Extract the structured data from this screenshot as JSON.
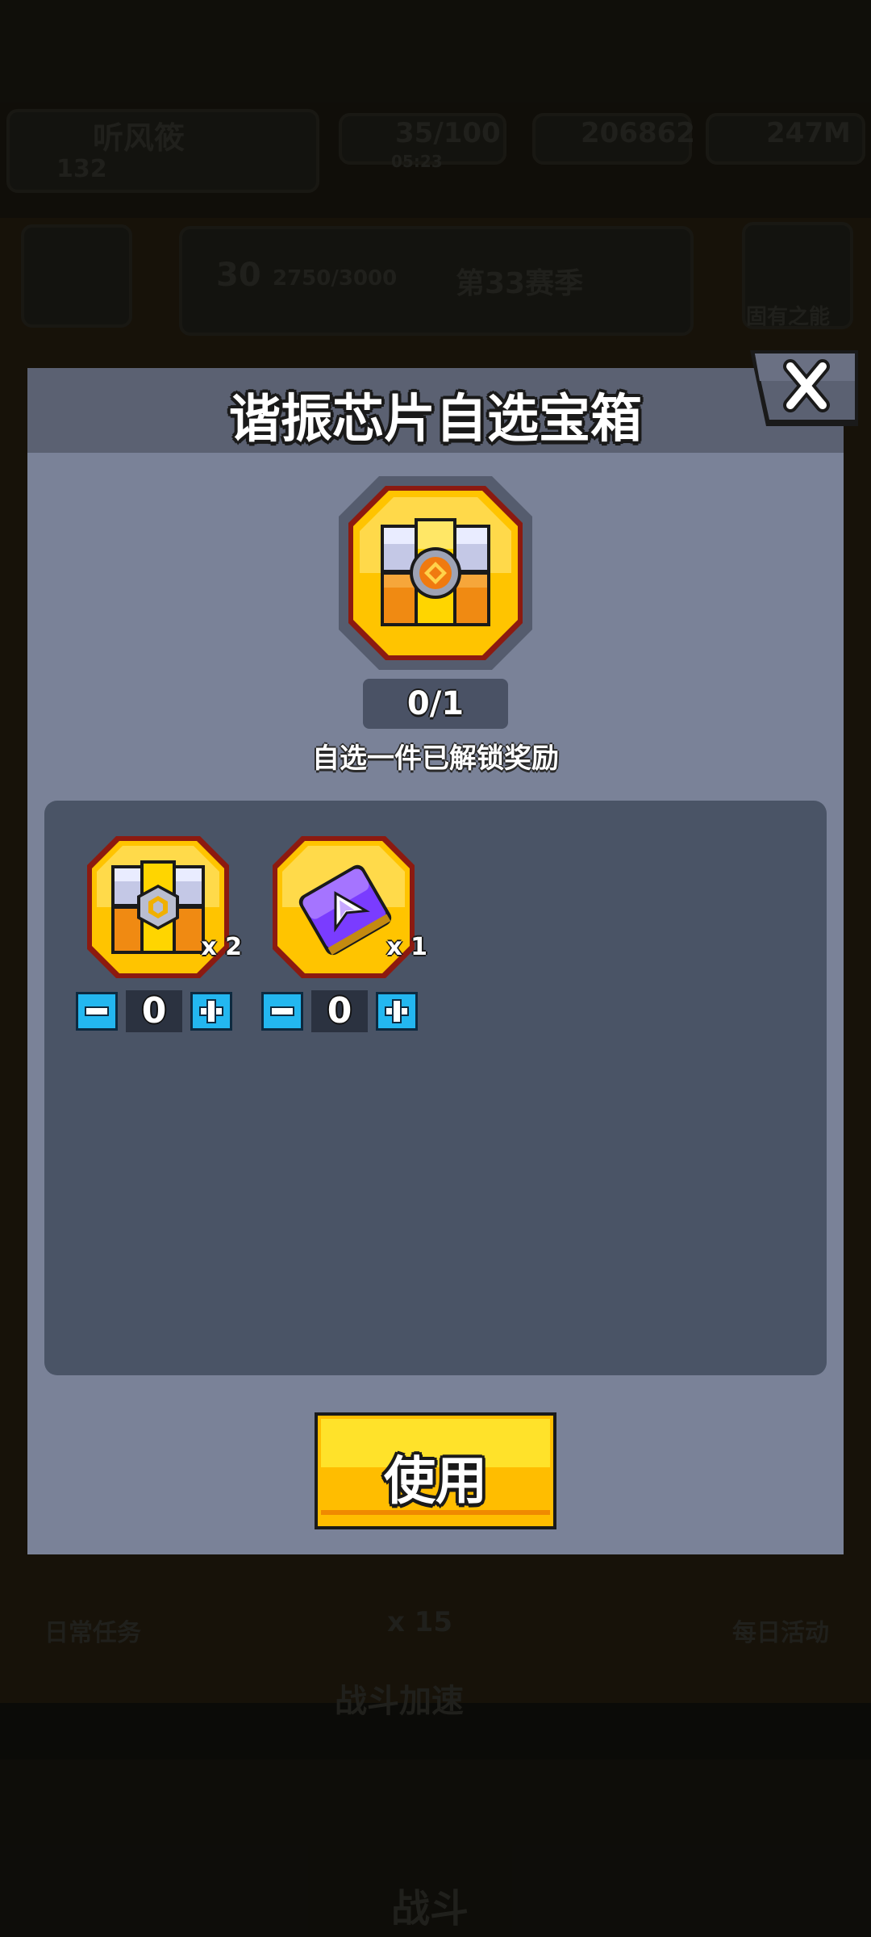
{
  "background": {
    "player_name": "听风筱",
    "player_power": "132",
    "energy": "35/100",
    "energy_timer": "05:23",
    "gold": "206862",
    "gems": "247M",
    "level_badge": "30",
    "level_progress": "2750/3000",
    "rank_text": "第33赛季",
    "daily_tasks_label": "日常任务",
    "events_label": "每日活动",
    "offline_reward": "x 15",
    "battle_speed_label": "战斗加速",
    "battle_button_label": "战斗",
    "ability_label": "固有之能"
  },
  "dialog": {
    "title": "谐振芯片自选宝箱",
    "selected_count": "0/1",
    "hint": "自选一件已解锁奖励",
    "items": [
      {
        "name": "chip-chest",
        "quantity_label": "x 2",
        "selected": "0"
      },
      {
        "name": "purple-blueprint",
        "quantity_label": "x 1",
        "selected": "0"
      }
    ],
    "use_button_label": "使用",
    "icons": {
      "close": "close-icon",
      "minus": "minus-icon",
      "plus": "plus-icon"
    }
  },
  "colors": {
    "dialog_body": "#7a8298",
    "dialog_header": "#5b6172",
    "reward_panel": "#4a5466",
    "gold": "#ffc400",
    "stepper_blue": "#23b7f0",
    "use_button": "#ffbd00"
  }
}
